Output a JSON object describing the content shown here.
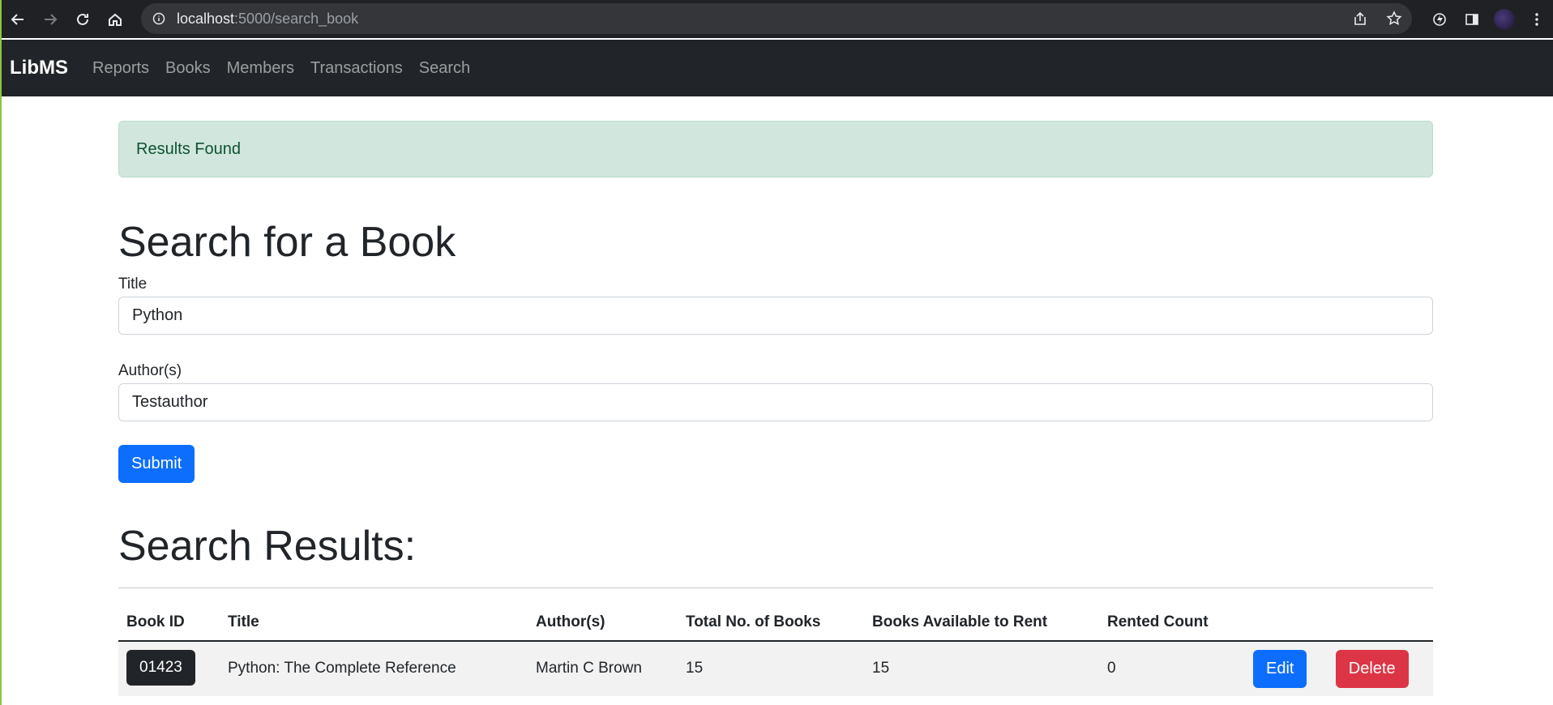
{
  "browser": {
    "url_host": "localhost",
    "url_path": ":5000/search_book"
  },
  "navbar": {
    "brand": "LibMS",
    "links": [
      "Reports",
      "Books",
      "Members",
      "Transactions",
      "Search"
    ]
  },
  "alert": {
    "message": "Results Found",
    "color": "#d1e7dd"
  },
  "form": {
    "heading": "Search for a Book",
    "title_label": "Title",
    "title_value": "Python",
    "author_label": "Author(s)",
    "author_value": "Testauthor",
    "submit_label": "Submit"
  },
  "results": {
    "heading": "Search Results:",
    "columns": [
      "Book ID",
      "Title",
      "Author(s)",
      "Total No. of Books",
      "Books Available to Rent",
      "Rented Count"
    ],
    "rows": [
      {
        "book_id": "01423",
        "title": "Python: The Complete Reference",
        "authors": "Martin C Brown",
        "total": "15",
        "available": "15",
        "rented": "0",
        "edit_label": "Edit",
        "delete_label": "Delete"
      }
    ]
  },
  "colors": {
    "primary": "#0d6efd",
    "danger": "#dc3545",
    "dark": "#212529"
  }
}
